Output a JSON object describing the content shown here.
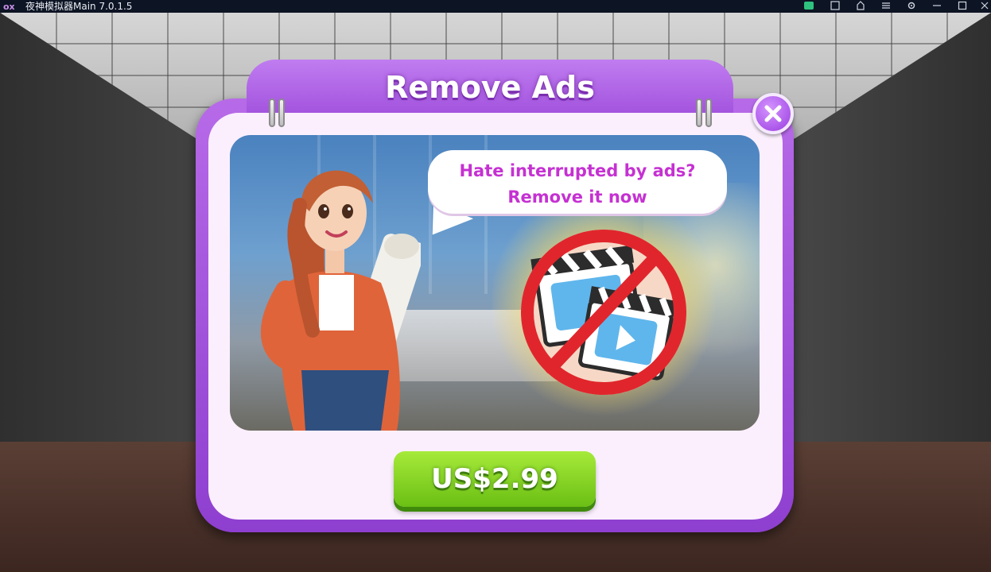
{
  "window": {
    "app_title": "夜神模拟器Main 7.0.1.5",
    "logo_text": "ox",
    "controls": [
      "toolbar-icon-1",
      "toolbar-icon-2",
      "toolbar-icon-3",
      "menu-icon",
      "settings-icon",
      "minimize-icon",
      "maximize-icon",
      "close-icon"
    ]
  },
  "dialog": {
    "title": "Remove Ads",
    "speech_line1": "Hate interrupted by ads?",
    "speech_line2": "Remove it now",
    "price_label": "US$2.99",
    "close_icon": "close-icon",
    "no_ads_icon": "no-video-ads-icon"
  },
  "colors": {
    "dialog_purple": "#a855e6",
    "speech_text": "#c531d2",
    "button_green": "#7fd01f",
    "no_sign_red": "#e0262c"
  }
}
